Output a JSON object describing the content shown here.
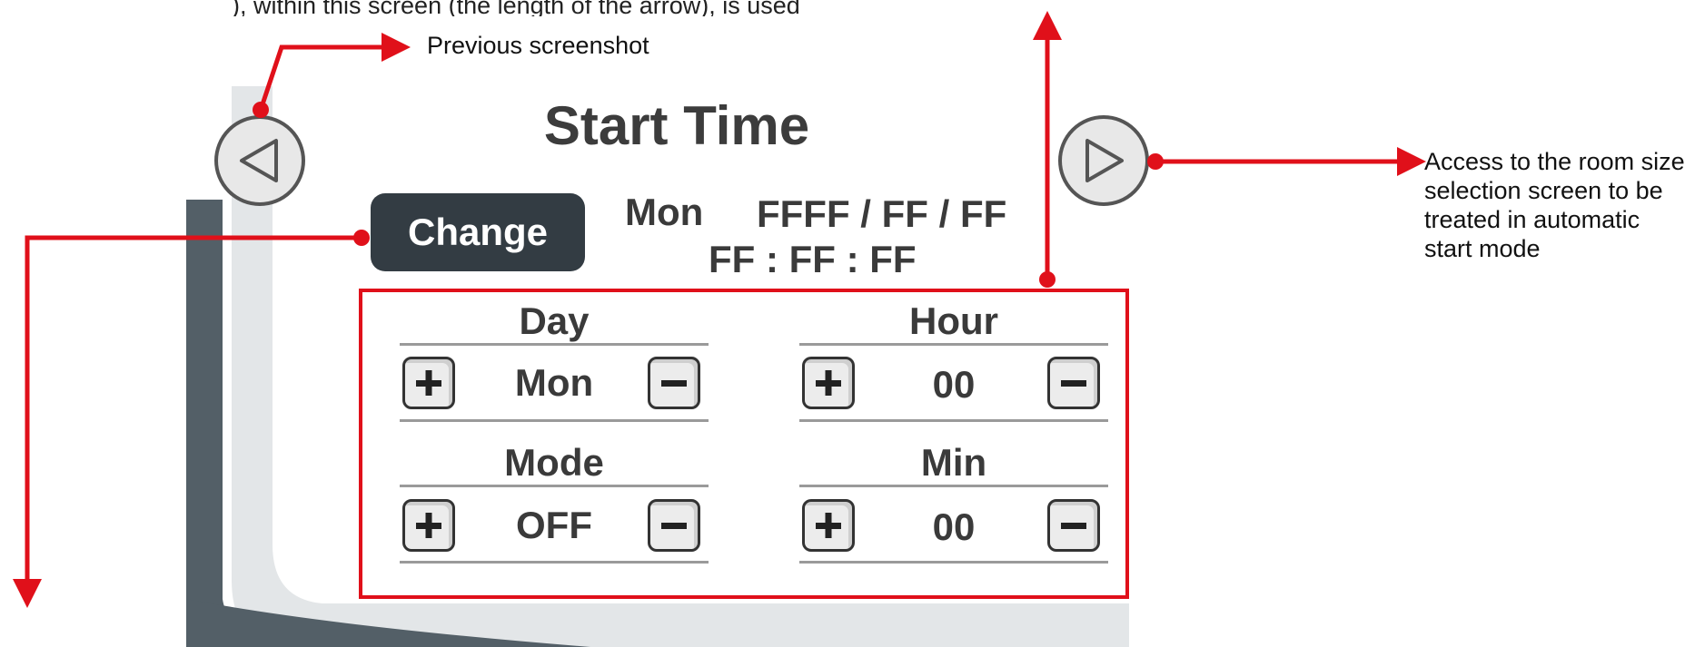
{
  "annotations": {
    "top_text_fragment": "), within this screen (the length of the arrow), is used",
    "previous_note": "Previous screenshot",
    "next_note": "Access to the room size selection screen to be treated in automatic start mode"
  },
  "screen": {
    "title": "Start Time",
    "change_label": "Change",
    "current_day": "Mon",
    "current_date": "FFFF / FF / FF",
    "current_time": "FF : FF : FF"
  },
  "fields": {
    "day": {
      "label": "Day",
      "value": "Mon"
    },
    "hour": {
      "label": "Hour",
      "value": "00"
    },
    "mode": {
      "label": "Mode",
      "value": "OFF"
    },
    "min": {
      "label": "Min",
      "value": "00"
    }
  },
  "icons": {
    "prev": "triangle-left-icon",
    "next": "triangle-right-icon",
    "increment": "plus-icon",
    "decrement": "minus-icon"
  },
  "colors": {
    "annotation_red": "#e0101a",
    "button_dark": "#333c43",
    "text_dark": "#3a3a3a",
    "panel_band_dark": "#535f67",
    "panel_band_light": "#e3e6e8"
  }
}
